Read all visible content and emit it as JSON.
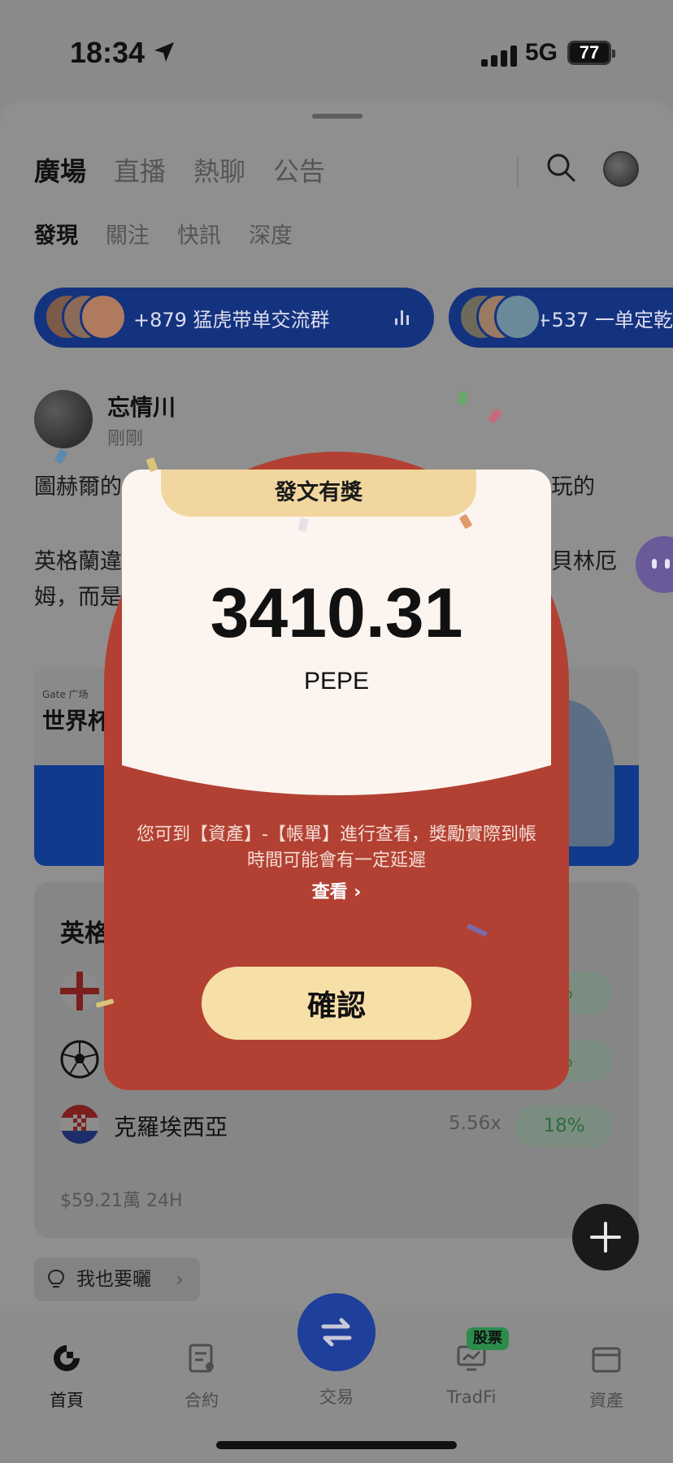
{
  "status_bar": {
    "time": "18:34",
    "network": "5G",
    "battery": "77"
  },
  "header": {
    "main_tabs": [
      "廣場",
      "直播",
      "熱聊",
      "公告"
    ],
    "sub_tabs": [
      "發現",
      "關注",
      "快訊",
      "深度"
    ]
  },
  "groups": [
    {
      "label": "+879 猛虎带单交流群"
    },
    {
      "label": "+537 一单定乾"
    }
  ],
  "post": {
    "author": "忘情川",
    "time": "剛剛",
    "line1_left": "圖赫爾的",
    "line1_right": "玩的",
    "line2_left": "英格蘭違",
    "line2_right": "貝林厄",
    "line3_left": "姆，而是"
  },
  "banner": {
    "brand": "Gate 广场",
    "title": "世界杯"
  },
  "market": {
    "title": "英格",
    "rows": [
      {
        "name": "",
        "odds": "",
        "pct": "%"
      },
      {
        "name": "",
        "odds": "",
        "pct": "%"
      },
      {
        "name": "克羅埃西亞",
        "odds": "5.56x",
        "pct": "18%"
      }
    ],
    "footer": "$59.21萬 24H"
  },
  "share_chip": "我也要曬",
  "modal": {
    "tab": "發文有獎",
    "amount": "3410.31",
    "unit": "PEPE",
    "note": "您可到【資產】-【帳單】進行查看，獎勵實際到帳時間可能會有一定延遲",
    "link": "查看 ›",
    "confirm": "確認"
  },
  "bottom_nav": {
    "home": "首頁",
    "futures": "合約",
    "trade": "交易",
    "tradfi": "TradFi",
    "assets": "資產",
    "stock_badge": "股票"
  },
  "colors": {
    "modal_red": "#b24133",
    "modal_card": "#fcf4ee",
    "modal_gold": "#f1d79f",
    "confirm_button": "#f7dfa8",
    "pill_blue": "#14337f",
    "trade_blue": "#1e3f9a",
    "overlay_gray": "#8c8c8c"
  }
}
